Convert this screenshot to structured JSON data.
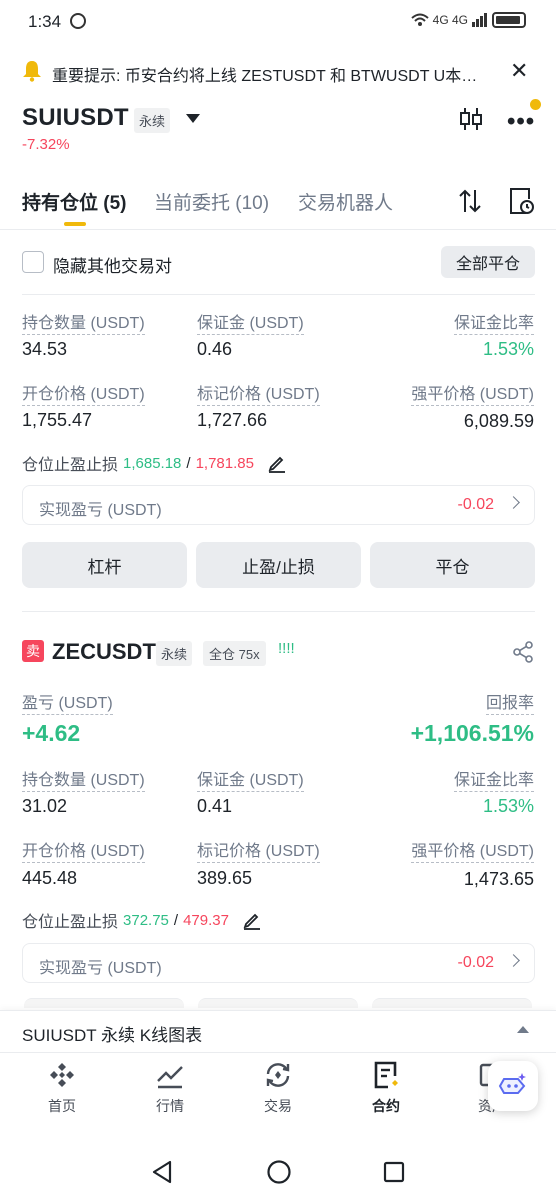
{
  "status": {
    "time": "1:34",
    "network": "4G 4G"
  },
  "notice": {
    "text": "重要提示: 币安合约将上线 ZESTUSDT 和 BTWUSDT U本…"
  },
  "header": {
    "symbol": "SUIUSDT",
    "type": "永续",
    "change": "-7.32%"
  },
  "tabs": [
    {
      "label": "持有仓位 (5)"
    },
    {
      "label": "当前委托 (10)"
    },
    {
      "label": "交易机器人"
    }
  ],
  "filter": {
    "hide_label": "隐藏其他交易对",
    "close_all": "全部平仓"
  },
  "position1": {
    "qty_label": "持仓数量 (USDT)",
    "qty": "34.53",
    "margin_label": "保证金 (USDT)",
    "margin": "0.46",
    "ratio_label": "保证金比率",
    "ratio": "1.53%",
    "entry_label": "开仓价格 (USDT)",
    "entry": "1,755.47",
    "mark_label": "标记价格 (USDT)",
    "mark": "1,727.66",
    "liq_label": "强平价格 (USDT)",
    "liq": "6,089.59",
    "tpsl_label": "仓位止盈止损",
    "tp": "1,685.18",
    "sep": "/",
    "sl": "1,781.85",
    "realized_label": "实现盈亏 (USDT)",
    "realized": "-0.02",
    "buttons": {
      "leverage": "杠杆",
      "tpsl": "止盈/止损",
      "close": "平仓"
    }
  },
  "position2": {
    "side": "卖",
    "symbol": "ZECUSDT",
    "type": "永续",
    "margin_mode": "全仓 75x",
    "bars": "!!!!",
    "pnl_label": "盈亏 (USDT)",
    "pnl": "+4.62",
    "roe_label": "回报率",
    "roe": "+1,106.51%",
    "qty_label": "持仓数量 (USDT)",
    "qty": "31.02",
    "margin_label": "保证金 (USDT)",
    "margin": "0.41",
    "ratio_label": "保证金比率",
    "ratio": "1.53%",
    "entry_label": "开仓价格 (USDT)",
    "entry": "445.48",
    "mark_label": "标记价格 (USDT)",
    "mark": "389.65",
    "liq_label": "强平价格 (USDT)",
    "liq": "1,473.65",
    "tpsl_label": "仓位止盈止损",
    "tp": "372.75",
    "sep": "/",
    "sl": "479.37",
    "realized_label": "实现盈亏 (USDT)",
    "realized": "-0.02"
  },
  "kline": {
    "label": "SUIUSDT 永续 K线图表"
  },
  "nav": [
    {
      "label": "首页"
    },
    {
      "label": "行情"
    },
    {
      "label": "交易"
    },
    {
      "label": "合约"
    },
    {
      "label": "资产"
    }
  ],
  "colors": {
    "accent": "#f0b90b",
    "up": "#2ebd85",
    "down": "#f6465d"
  }
}
